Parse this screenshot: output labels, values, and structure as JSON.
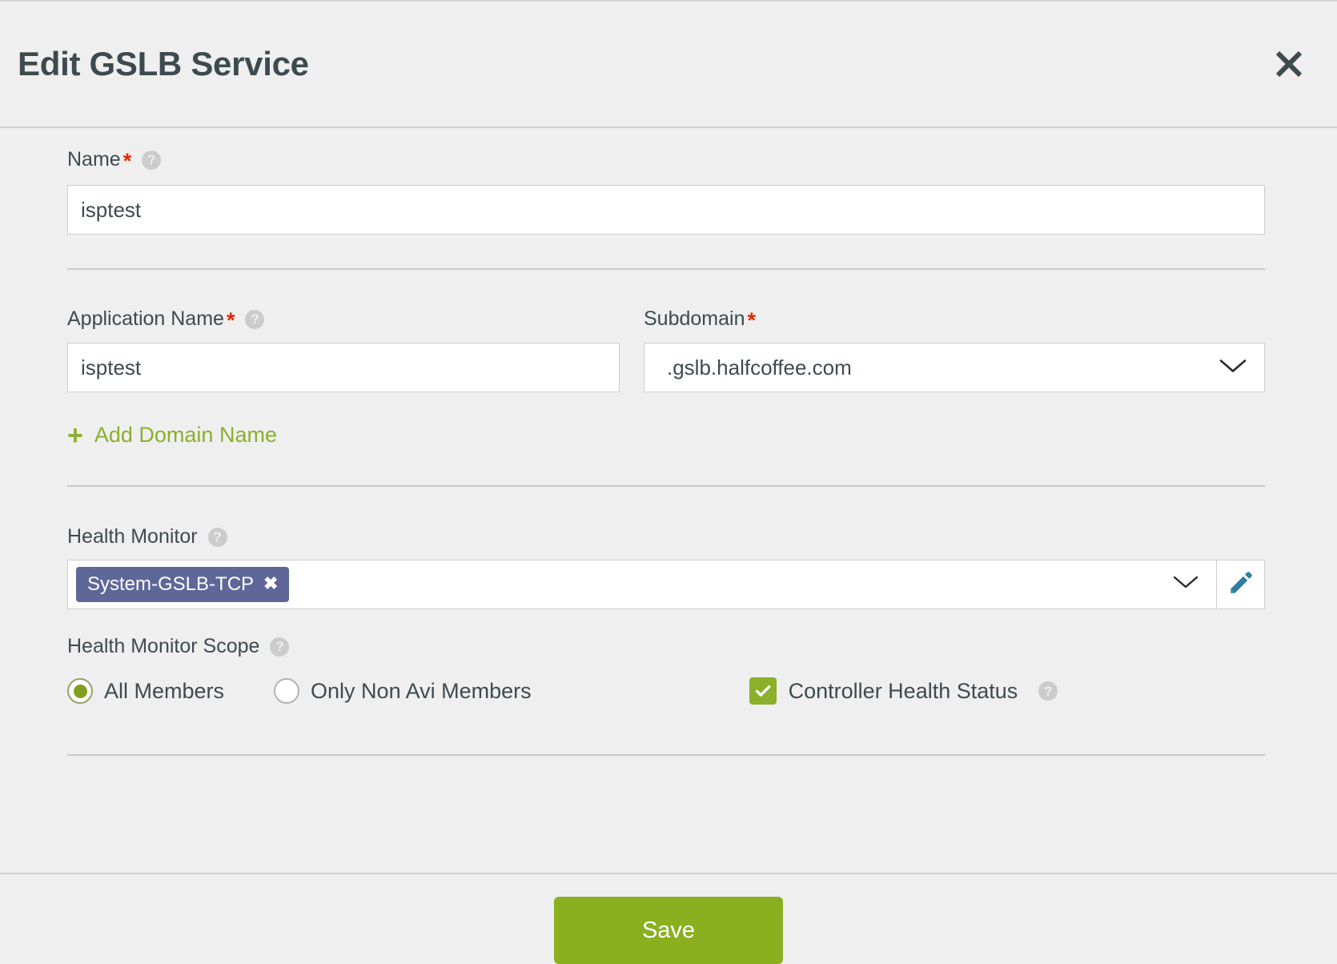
{
  "header": {
    "title": "Edit GSLB Service",
    "close_icon": "close-icon"
  },
  "form": {
    "name": {
      "label": "Name",
      "required_marker": "*",
      "help_icon": "?",
      "value": "isptest",
      "placeholder": ""
    },
    "application_name": {
      "label": "Application Name",
      "required_marker": "*",
      "help_icon": "?",
      "value": "isptest",
      "placeholder": ""
    },
    "subdomain": {
      "label": "Subdomain",
      "required_marker": "*",
      "value": ".gslb.halfcoffee.com",
      "chevron_icon": "chevron-down-icon"
    },
    "add_domain": {
      "plus": "+",
      "label": "Add Domain Name"
    },
    "health_monitor": {
      "label": "Health Monitor",
      "help_icon": "?",
      "chips": [
        {
          "label": "System-GSLB-TCP",
          "remove_icon": "✖"
        }
      ],
      "chevron_icon": "chevron-down-icon",
      "edit_icon": "pencil-icon"
    },
    "health_monitor_scope": {
      "label": "Health Monitor Scope",
      "help_icon": "?",
      "options": [
        {
          "label": "All Members",
          "selected": true
        },
        {
          "label": "Only Non Avi Members",
          "selected": false
        }
      ]
    },
    "controller_health_status": {
      "label": "Controller Health Status",
      "help_icon": "?",
      "checked": true,
      "check_icon": "check-icon"
    }
  },
  "footer": {
    "save_label": "Save"
  },
  "colors": {
    "accent_green": "#8ab020",
    "chip_purple": "#5f6799",
    "required_red": "#e62700",
    "pencil_blue": "#2e7fa0",
    "text": "#3d4b50"
  }
}
